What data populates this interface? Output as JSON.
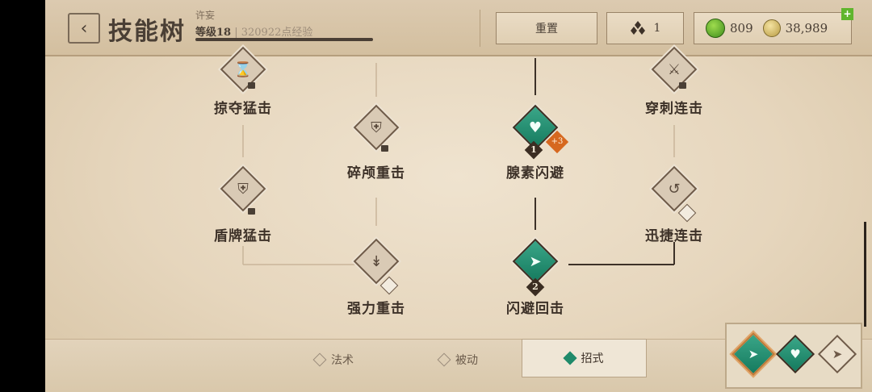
{
  "header": {
    "back_icon": "chevron-left-icon",
    "title": "技能树",
    "player_name": "许妄",
    "level": "等级18",
    "exp": "| 320922点经验",
    "reset_label": "重置",
    "skill_points_icon": "triple-diamond-icon",
    "skill_points": "1",
    "gems": "809",
    "coins": "38,989",
    "add_icon": "plus-icon"
  },
  "skills": [
    {
      "id": "plunder-strike",
      "label": "掠夺猛击",
      "icon": "hourglass-icon",
      "locked": true,
      "active": false
    },
    {
      "id": "pierce-combo",
      "label": "穿刺连击",
      "icon": "blade-icon",
      "locked": true,
      "active": false
    },
    {
      "id": "skull-crush",
      "label": "碎颅重击",
      "icon": "shield-split-icon",
      "locked": true,
      "active": false
    },
    {
      "id": "adrenaline-dodge",
      "label": "腺素闪避",
      "icon": "heart-wing-icon",
      "locked": false,
      "active": true,
      "rank": "1",
      "bonus": "+3"
    },
    {
      "id": "shield-bash",
      "label": "盾牌猛击",
      "icon": "shield-icon",
      "locked": true,
      "active": false
    },
    {
      "id": "swift-combo",
      "label": "迅捷连击",
      "icon": "sword-swirl-icon",
      "locked": false,
      "active": false
    },
    {
      "id": "power-strike",
      "label": "强力重击",
      "icon": "sword-down-icon",
      "locked": false,
      "active": false
    },
    {
      "id": "dodge-counter",
      "label": "闪避回击",
      "icon": "dash-icon",
      "locked": false,
      "active": true,
      "rank": "2"
    }
  ],
  "tabs": [
    {
      "label": "法术",
      "selected": false
    },
    {
      "label": "被动",
      "selected": false
    },
    {
      "label": "招式",
      "selected": true
    }
  ],
  "colors": {
    "active_skill": "#1f8a6a",
    "bonus_badge": "#d6681f",
    "text_dark": "#3d3128"
  }
}
